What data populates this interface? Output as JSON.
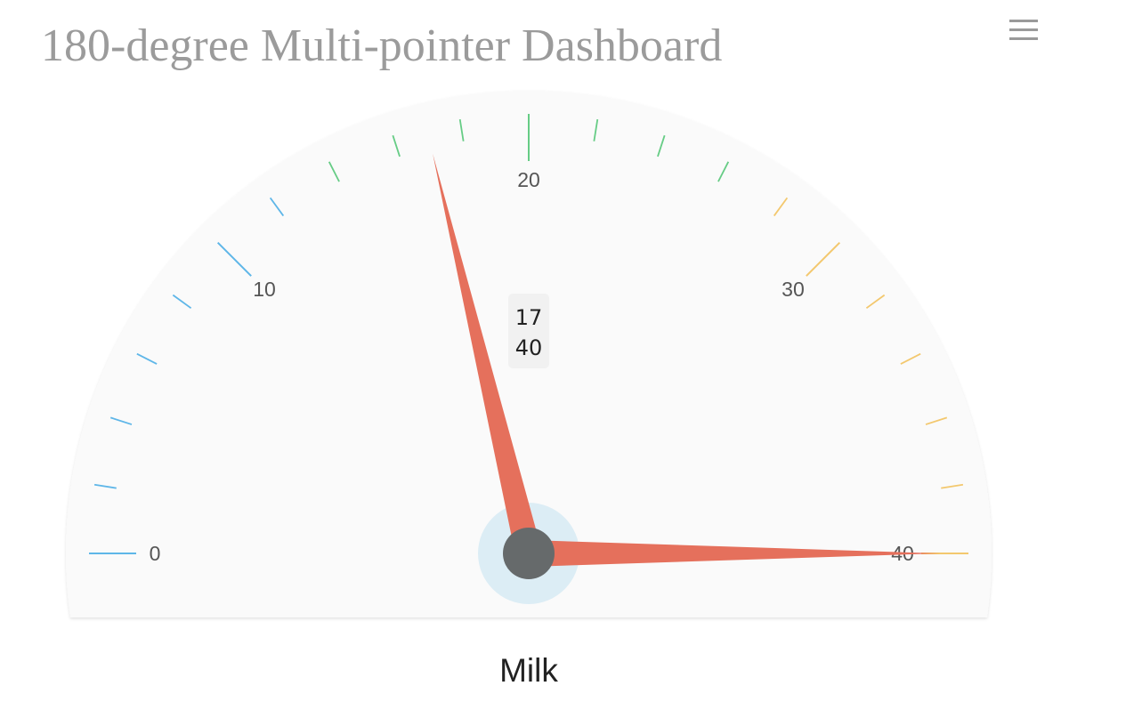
{
  "header": {
    "title": "180-degree Multi-pointer Dashboard",
    "menu_icon": "hamburger-menu-icon"
  },
  "chart_data": {
    "type": "gauge",
    "title": "180-degree Multi-pointer Dashboard",
    "min": 0,
    "max": 40,
    "start_angle_deg": 0,
    "end_angle_deg": 180,
    "major_ticks": [
      0,
      10,
      20,
      30,
      40
    ],
    "tick_labels": [
      "0",
      "10",
      "20",
      "30",
      "40"
    ],
    "minor_interval": 2,
    "bands": [
      {
        "from": 0,
        "to": 14,
        "color": "#5eb6e8"
      },
      {
        "from": 14,
        "to": 28,
        "color": "#66cc85"
      },
      {
        "from": 28,
        "to": 40,
        "color": "#f3c86e"
      }
    ],
    "series_name": "Milk",
    "pointers": [
      {
        "value": 17,
        "color": "#e5705c"
      },
      {
        "value": 40,
        "color": "#e5705c"
      }
    ],
    "value_labels": [
      "17",
      "40"
    ],
    "colors": {
      "face": "#fafafa",
      "hub": "#666a6b",
      "hub_halo": "#dcedf5",
      "label_box": "#f1f1f1"
    }
  }
}
